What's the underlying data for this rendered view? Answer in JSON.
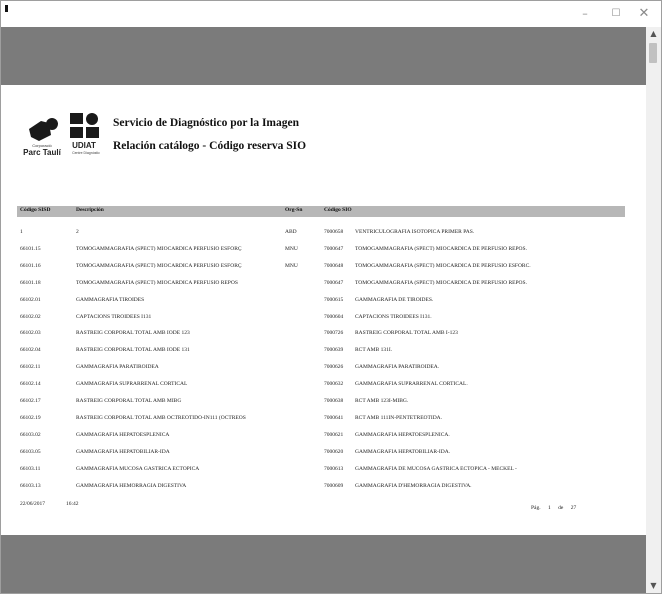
{
  "window": {
    "minimize_glyph": "–",
    "maximize_glyph": "☐",
    "close_glyph": "✕"
  },
  "scrollbar": {
    "up_glyph": "▲",
    "down_glyph": "▼"
  },
  "logos": {
    "parc": {
      "small_text": "Corporació",
      "name": "Parc Taulí"
    },
    "udiat": {
      "name": "UDIAT",
      "small_text": "Centre Diagnòstic"
    }
  },
  "report": {
    "title": "Servicio de Diagnóstico por la Imagen",
    "subtitle": "Relación catálogo - Código reserva SIO"
  },
  "columns": {
    "code": "Código SISD",
    "description": "Descripción",
    "org": "Org-Sn",
    "sio_code": "Código SIO"
  },
  "rows": [
    {
      "code": "1",
      "description": "2",
      "org": "ABD",
      "sio_code": "7000658",
      "sio_description": "VENTRICULOGRAFIA ISOTOPICA PRIMER PAS."
    },
    {
      "code": "66101.15",
      "description": "TOMOGAMMAGRAFIA (SPECT) MIOCARDICA PERFUSIO ESFORÇ",
      "org": "MNU",
      "sio_code": "7000647",
      "sio_description": "TOMOGAMMAGRAFIA (SPECT) MIOCARDICA DE PERFUSIO REPOS."
    },
    {
      "code": "66101.16",
      "description": "TOMOGAMMAGRAFIA (SPECT) MIOCARDICA PERFUSIO ESFORÇ",
      "org": "MNU",
      "sio_code": "7000648",
      "sio_description": "TOMOGAMMAGRAFIA (SPECT) MIOCARDICA DE PERFUSIO ESFORC."
    },
    {
      "code": "66101.18",
      "description": "TOMOGAMMAGRAFIA (SPECT) MIOCARDICA PERFUSIO REPOS",
      "org": "",
      "sio_code": "7000647",
      "sio_description": "TOMOGAMMAGRAFIA (SPECT) MIOCARDICA DE PERFUSIO REPOS."
    },
    {
      "code": "66102.01",
      "description": "GAMMAGRAFIA TIROIDES",
      "org": "",
      "sio_code": "7000615",
      "sio_description": "GAMMAGRAFIA DE TIROIDES."
    },
    {
      "code": "66102.02",
      "description": "CAPTACIONS TIROIDEES I131",
      "org": "",
      "sio_code": "7000604",
      "sio_description": "CAPTACIONS TIROIDEES I131."
    },
    {
      "code": "66102.03",
      "description": "RASTREIG CORPORAL TOTAL AMB IODE 123",
      "org": "",
      "sio_code": "7000726",
      "sio_description": "RASTREIG CORPORAL TOTAL AMB I-123"
    },
    {
      "code": "66102.04",
      "description": "RASTREIG CORPORAL TOTAL AMB IODE 131",
      "org": "",
      "sio_code": "7000639",
      "sio_description": "RCT AMB 131I."
    },
    {
      "code": "66102.11",
      "description": "GAMMAGRAFIA PARATIROIDEA",
      "org": "",
      "sio_code": "7000626",
      "sio_description": "GAMMAGRAFIA PARATIROIDEA."
    },
    {
      "code": "66102.14",
      "description": "GAMMAGRAFIA SUPRARRENAL CORTICAL",
      "org": "",
      "sio_code": "7000632",
      "sio_description": "GAMMAGRAFIA SUPRARRENAL CORTICAL."
    },
    {
      "code": "66102.17",
      "description": "RASTREIG CORPORAL TOTAL AMB MIBG",
      "org": "",
      "sio_code": "7000638",
      "sio_description": "RCT AMB 123I-MIBG."
    },
    {
      "code": "66102.19",
      "description": "RASTREIG CORPORAL TOTAL AMB OCTREOTIDO-IN111 (OCTREOS",
      "org": "",
      "sio_code": "7000641",
      "sio_description": "RCT AMB 111IN-PENTETREOTIDA."
    },
    {
      "code": "66103.02",
      "description": "GAMMAGRAFIA HEPATOESPLENICA",
      "org": "",
      "sio_code": "7000621",
      "sio_description": "GAMMAGRAFIA HEPATOESPLENICA."
    },
    {
      "code": "66103.05",
      "description": "GAMMAGRAFIA HEPATOBILIAR-IDA",
      "org": "",
      "sio_code": "7000620",
      "sio_description": "GAMMAGRAFIA HEPATOBILIAR-IDA."
    },
    {
      "code": "66103.11",
      "description": "GAMMAGRAFIA MUCOSA GASTRICA ECTOPICA",
      "org": "",
      "sio_code": "7000613",
      "sio_description": "GAMMAGRAFIA DE MUCOSA GASTRICA ECTOPICA - MECKEL -"
    },
    {
      "code": "66103.13",
      "description": "GAMMAGRAFIA HEMORRAGIA DIGESTIVA",
      "org": "",
      "sio_code": "7000609",
      "sio_description": "GAMMAGRAFIA D'HEMORRAGIA DIGESTIVA."
    }
  ],
  "footer": {
    "date": "22/06/2017",
    "time": "16:42",
    "page_label": "Pág.",
    "page_current": "1",
    "page_of": "de",
    "page_total": "27"
  }
}
